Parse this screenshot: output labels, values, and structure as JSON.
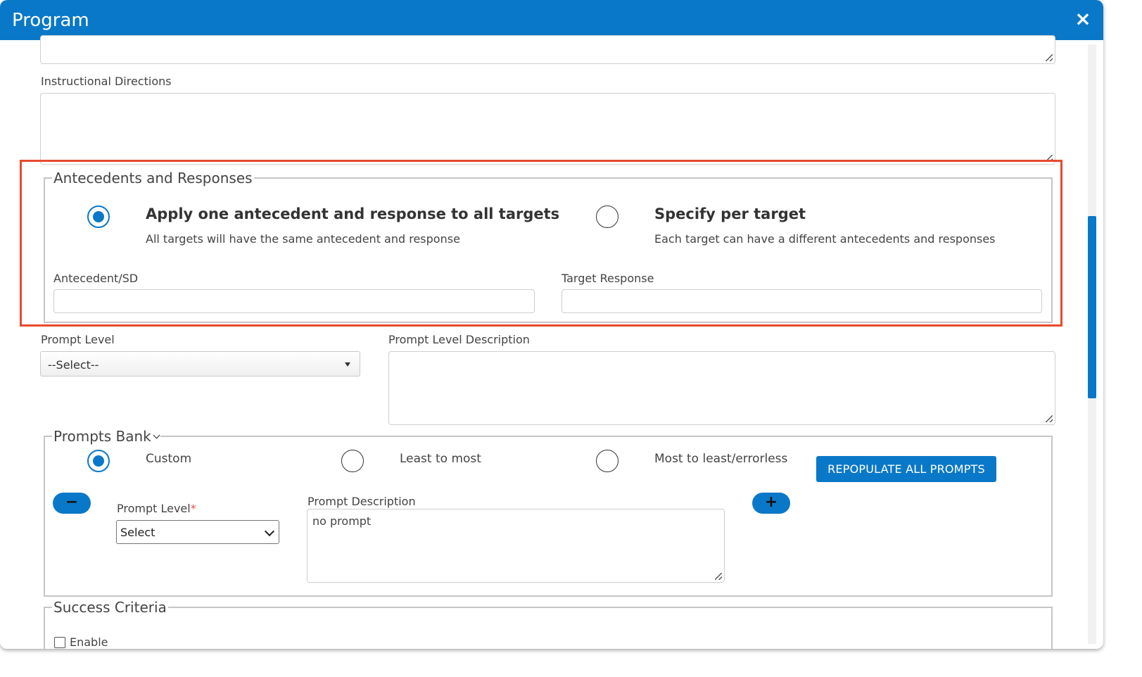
{
  "modal": {
    "title": "Program",
    "close_symbol": "×"
  },
  "colors": {
    "header": "#0a78c8",
    "accent": "#0a78c8",
    "highlight_border": "#e8492e"
  },
  "instructional_directions": {
    "label": "Instructional Directions",
    "value": ""
  },
  "antecedents": {
    "legend": "Antecedents and Responses",
    "options": [
      {
        "title": "Apply one antecedent and response to all targets",
        "description": "All targets will have the same antecedent and response",
        "checked": true
      },
      {
        "title": "Specify per target",
        "description": "Each target can have a different antecedents and responses",
        "checked": false
      }
    ],
    "antecedent_label": "Antecedent/SD",
    "antecedent_value": "",
    "target_response_label": "Target Response",
    "target_response_value": ""
  },
  "prompt_level": {
    "label": "Prompt Level",
    "selected": "--Select--",
    "description_label": "Prompt Level Description",
    "description_value": ""
  },
  "prompts_bank": {
    "legend": "Prompts Bank",
    "options": [
      {
        "label": "Custom",
        "checked": true
      },
      {
        "label": "Least to most",
        "checked": false
      },
      {
        "label": "Most to least/errorless",
        "checked": false
      }
    ],
    "repopulate_label": "REPOPULATE ALL PROMPTS",
    "remove_symbol": "−",
    "add_symbol": "+",
    "prompt_level_label": "Prompt Level",
    "required_marker": "*",
    "prompt_level_selected": "Select",
    "prompt_description_label": "Prompt Description",
    "prompt_description_value": "no prompt"
  },
  "success_criteria": {
    "legend": "Success Criteria",
    "enable_label": "Enable"
  }
}
